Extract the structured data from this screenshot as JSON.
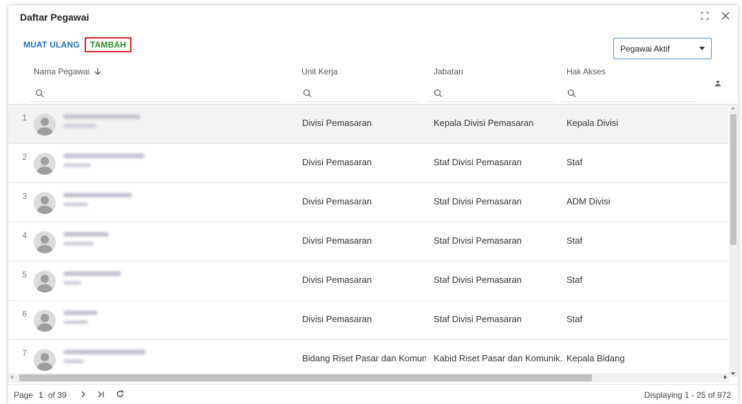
{
  "window": {
    "title": "Daftar Pegawai"
  },
  "toolbar": {
    "reload_label": "MUAT ULANG",
    "add_label": "TAMBAH",
    "filter_selected": "Pegawai Aktif"
  },
  "columns": {
    "name": "Nama Pegawai",
    "unit": "Unit Kerja",
    "jabatan": "Jabatan",
    "hak": "Hak Akses"
  },
  "rows": [
    {
      "num": "1",
      "unit": "Divisi Pemasaran",
      "jabatan": "Kepala Divisi Pemasaran",
      "hak": "Kepala Divisi"
    },
    {
      "num": "2",
      "unit": "Divisi Pemasaran",
      "jabatan": "Staf Divisi Pemasaran",
      "hak": "Staf"
    },
    {
      "num": "3",
      "unit": "Divisi Pemasaran",
      "jabatan": "Staf Divisi Pemasaran",
      "hak": "ADM Divisi"
    },
    {
      "num": "4",
      "unit": "Divisi Pemasaran",
      "jabatan": "Staf Divisi Pemasaran",
      "hak": "Staf"
    },
    {
      "num": "5",
      "unit": "Divisi Pemasaran",
      "jabatan": "Staf Divisi Pemasaran",
      "hak": "Staf"
    },
    {
      "num": "6",
      "unit": "Divisi Pemasaran",
      "jabatan": "Staf Divisi Pemasaran",
      "hak": "Staf"
    },
    {
      "num": "7",
      "unit": "Bidang Riset Pasar dan Komuni...",
      "jabatan": "Kabid Riset Pasar dan Komunik...",
      "hak": "Kepala Bidang"
    }
  ],
  "pager": {
    "page_label": "Page",
    "page_number": "1",
    "of_label": "of 39",
    "displaying": "Displaying 1 - 25 of 972"
  },
  "colors": {
    "link_blue": "#1e6fb8",
    "add_green": "#2a8a2a",
    "highlight_red": "#dd2222"
  }
}
